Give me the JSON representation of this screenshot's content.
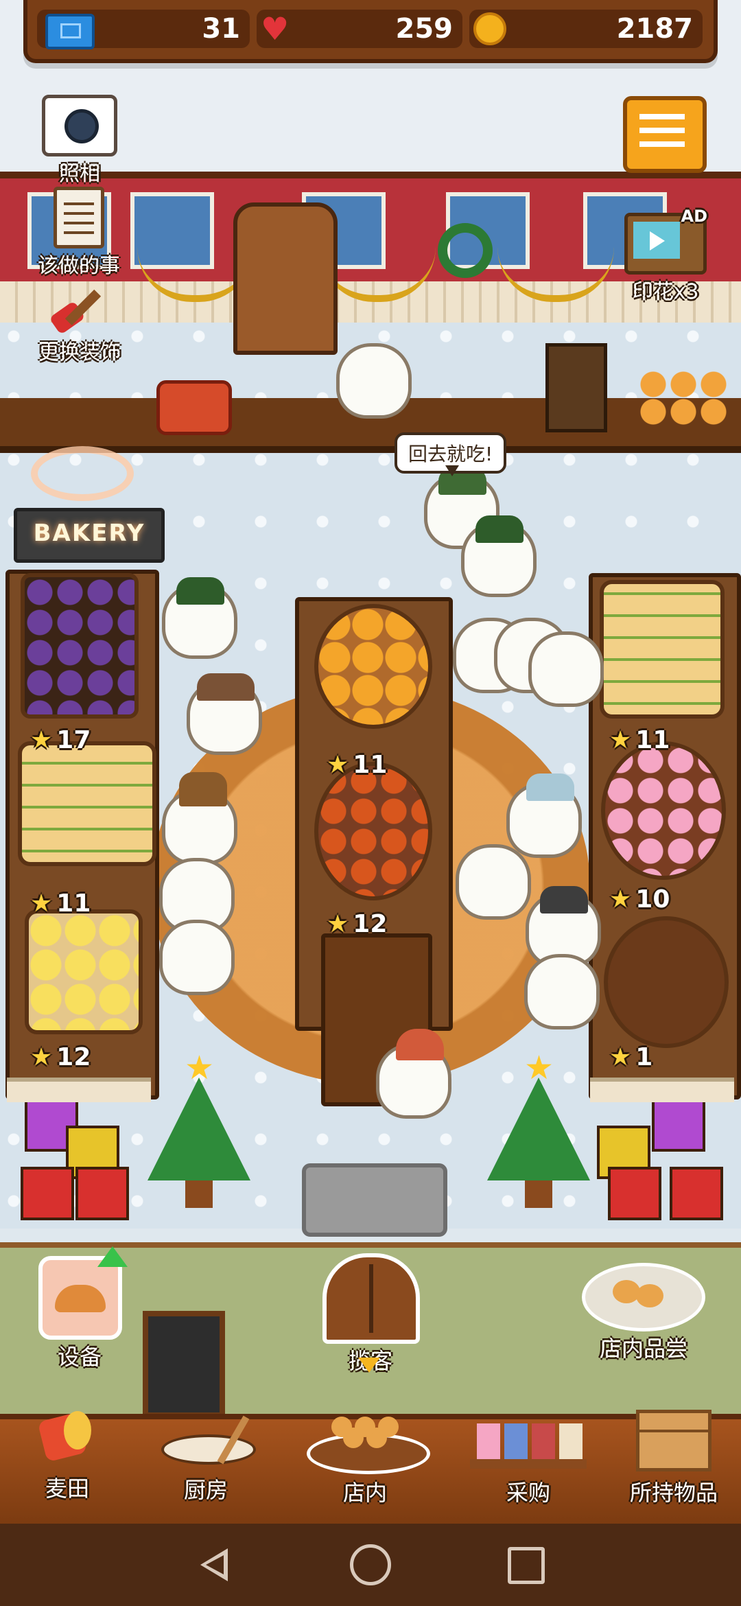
{
  "stats": {
    "tickets": "31",
    "hearts": "259",
    "coins": "2187"
  },
  "hud": {
    "camera_label": "照相",
    "todo_label": "该做的事",
    "decorate_label": "更换装饰",
    "stamp_label": "印花x3",
    "ad_badge": "AD"
  },
  "scene": {
    "speech_bubble": "回去就吃!",
    "bakery_sign": "BAKERY",
    "shelf_stars": {
      "left_middle": "17",
      "left_lower": "11",
      "left_bottom": "12",
      "center_upper": "11",
      "center_lower": "12",
      "right_upper": "11",
      "right_middle": "10",
      "right_bottom": "1"
    }
  },
  "actions": {
    "equipment_label": "设备",
    "invite_label": "揽客",
    "tasting_label": "店内品尝"
  },
  "nav": {
    "items": [
      {
        "label": "麦田",
        "icon": "wheat-field-icon"
      },
      {
        "label": "厨房",
        "icon": "kitchen-icon"
      },
      {
        "label": "店内",
        "icon": "shop-icon"
      },
      {
        "label": "采购",
        "icon": "purchase-icon"
      },
      {
        "label": "所持物品",
        "icon": "inventory-box-icon"
      }
    ]
  },
  "colors": {
    "wood_dark": "#5b2a0d",
    "wood": "#7a3e16",
    "wall_red": "#b8323a",
    "grass": "#a9b57e",
    "accent_gold": "#f6a41c",
    "heart": "#e3343a"
  }
}
